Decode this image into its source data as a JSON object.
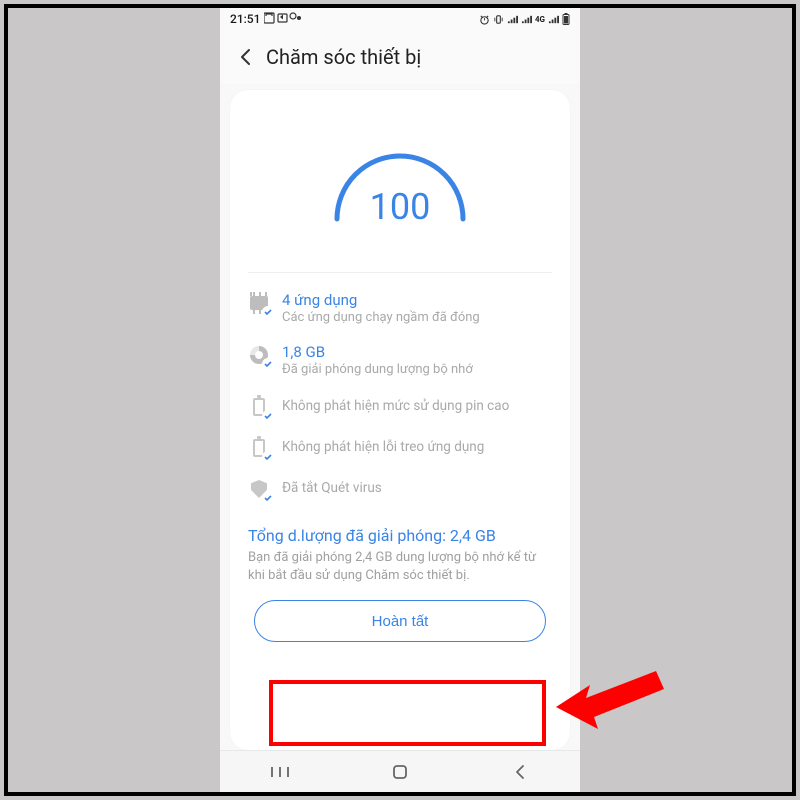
{
  "status": {
    "time": "21:51",
    "network_label": "4G"
  },
  "header": {
    "title": "Chăm sóc thiết bị"
  },
  "score": {
    "value": "100"
  },
  "items": {
    "apps": {
      "title": "4 ứng dụng",
      "sub": "Các ứng dụng chạy ngầm đã đóng"
    },
    "storage": {
      "title": "1,8 GB",
      "sub": "Đã giải phóng dung lượng bộ nhớ"
    },
    "battery": {
      "text": "Không phát hiện mức sử dụng pin cao"
    },
    "crash": {
      "text": "Không phát hiện lỗi treo ứng dụng"
    },
    "virus": {
      "text": "Đã tắt Quét virus"
    }
  },
  "summary": {
    "title": "Tổng d.lượng đã giải phóng: 2,4 GB",
    "sub": "Bạn đã giải phóng 2,4 GB dung lượng bộ nhớ kể từ khi bắt đầu sử dụng Chăm sóc thiết bị."
  },
  "button": {
    "done": "Hoàn tất"
  }
}
